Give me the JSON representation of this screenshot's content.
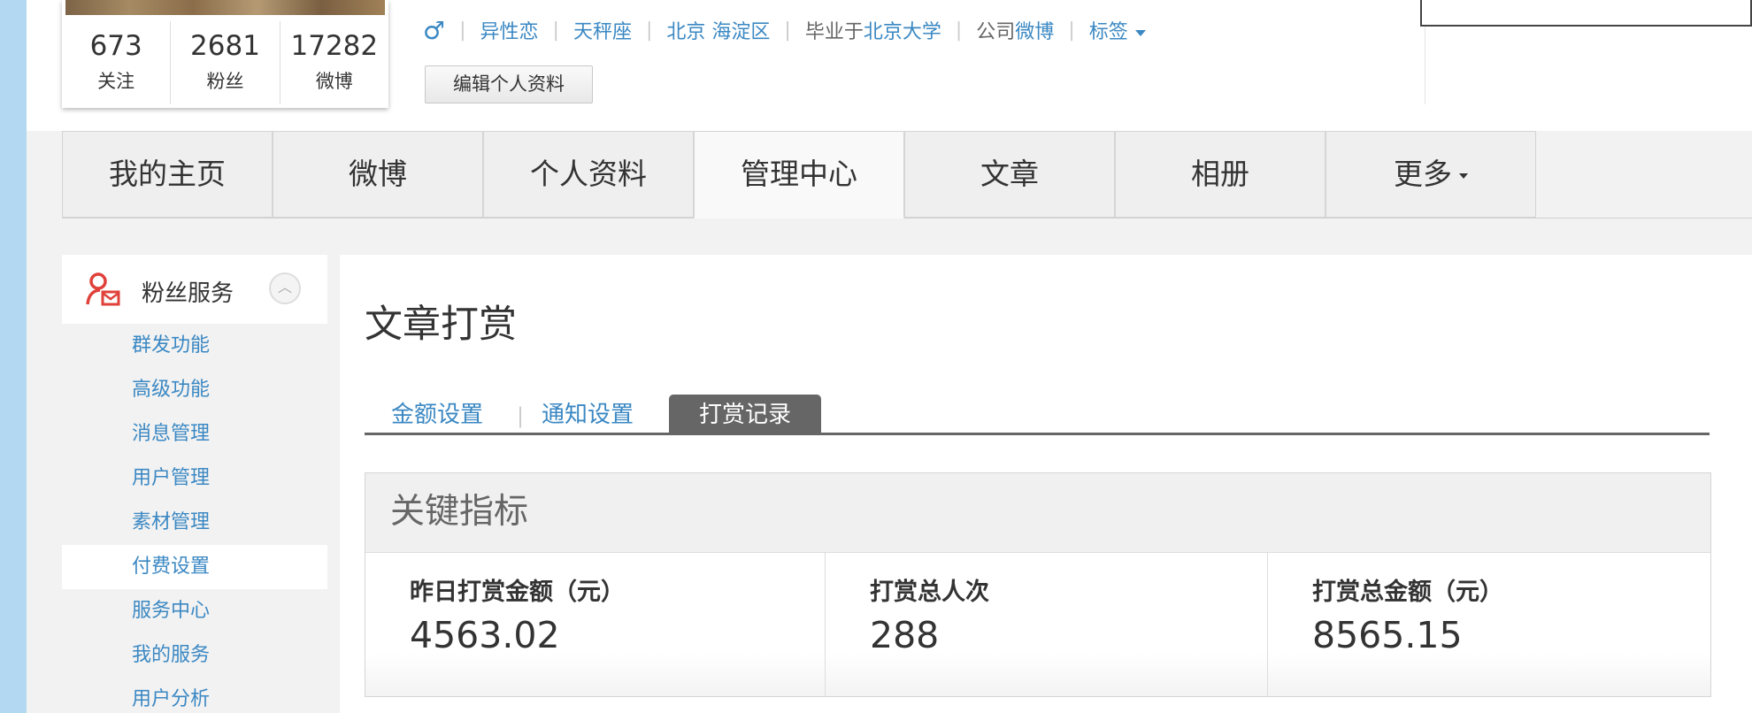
{
  "profile": {
    "stats": [
      {
        "value": "673",
        "label": "关注"
      },
      {
        "value": "2681",
        "label": "粉丝"
      },
      {
        "value": "17282",
        "label": "微博"
      }
    ],
    "info": {
      "gender_icon": "♂",
      "orientation": "异性恋",
      "zodiac": "天秤座",
      "location": "北京 海淀区",
      "grad_prefix": "毕业于",
      "school": "北京大学",
      "company_prefix": "公司",
      "company": "微博",
      "tags": "标签"
    },
    "edit_button": "编辑个人资料"
  },
  "nav": {
    "tabs": [
      {
        "label": "我的主页"
      },
      {
        "label": "微博"
      },
      {
        "label": "个人资料"
      },
      {
        "label": "管理中心",
        "active": true
      },
      {
        "label": "文章"
      },
      {
        "label": "相册"
      },
      {
        "label": "更多"
      }
    ]
  },
  "sidebar": {
    "title": "粉丝服务",
    "icon": "fans-service-icon",
    "items": [
      {
        "label": "群发功能"
      },
      {
        "label": "高级功能"
      },
      {
        "label": "消息管理"
      },
      {
        "label": "用户管理"
      },
      {
        "label": "素材管理"
      },
      {
        "label": "付费设置",
        "selected": true
      },
      {
        "label": "服务中心"
      },
      {
        "label": "我的服务"
      },
      {
        "label": "用户分析"
      }
    ]
  },
  "main": {
    "title": "文章打赏",
    "subtabs": [
      {
        "label": "金额设置"
      },
      {
        "label": "通知设置"
      },
      {
        "label": "打赏记录",
        "active": true
      }
    ],
    "kpi": {
      "heading": "关键指标",
      "items": [
        {
          "label": "昨日打赏金额（元）",
          "value": "4563.02"
        },
        {
          "label": "打赏总人次",
          "value": "288"
        },
        {
          "label": "打赏总金额（元）",
          "value": "8565.15"
        }
      ]
    }
  },
  "colors": {
    "link": "#3b88c3",
    "active_subtab": "#666666",
    "icon_red": "#e0413a"
  }
}
